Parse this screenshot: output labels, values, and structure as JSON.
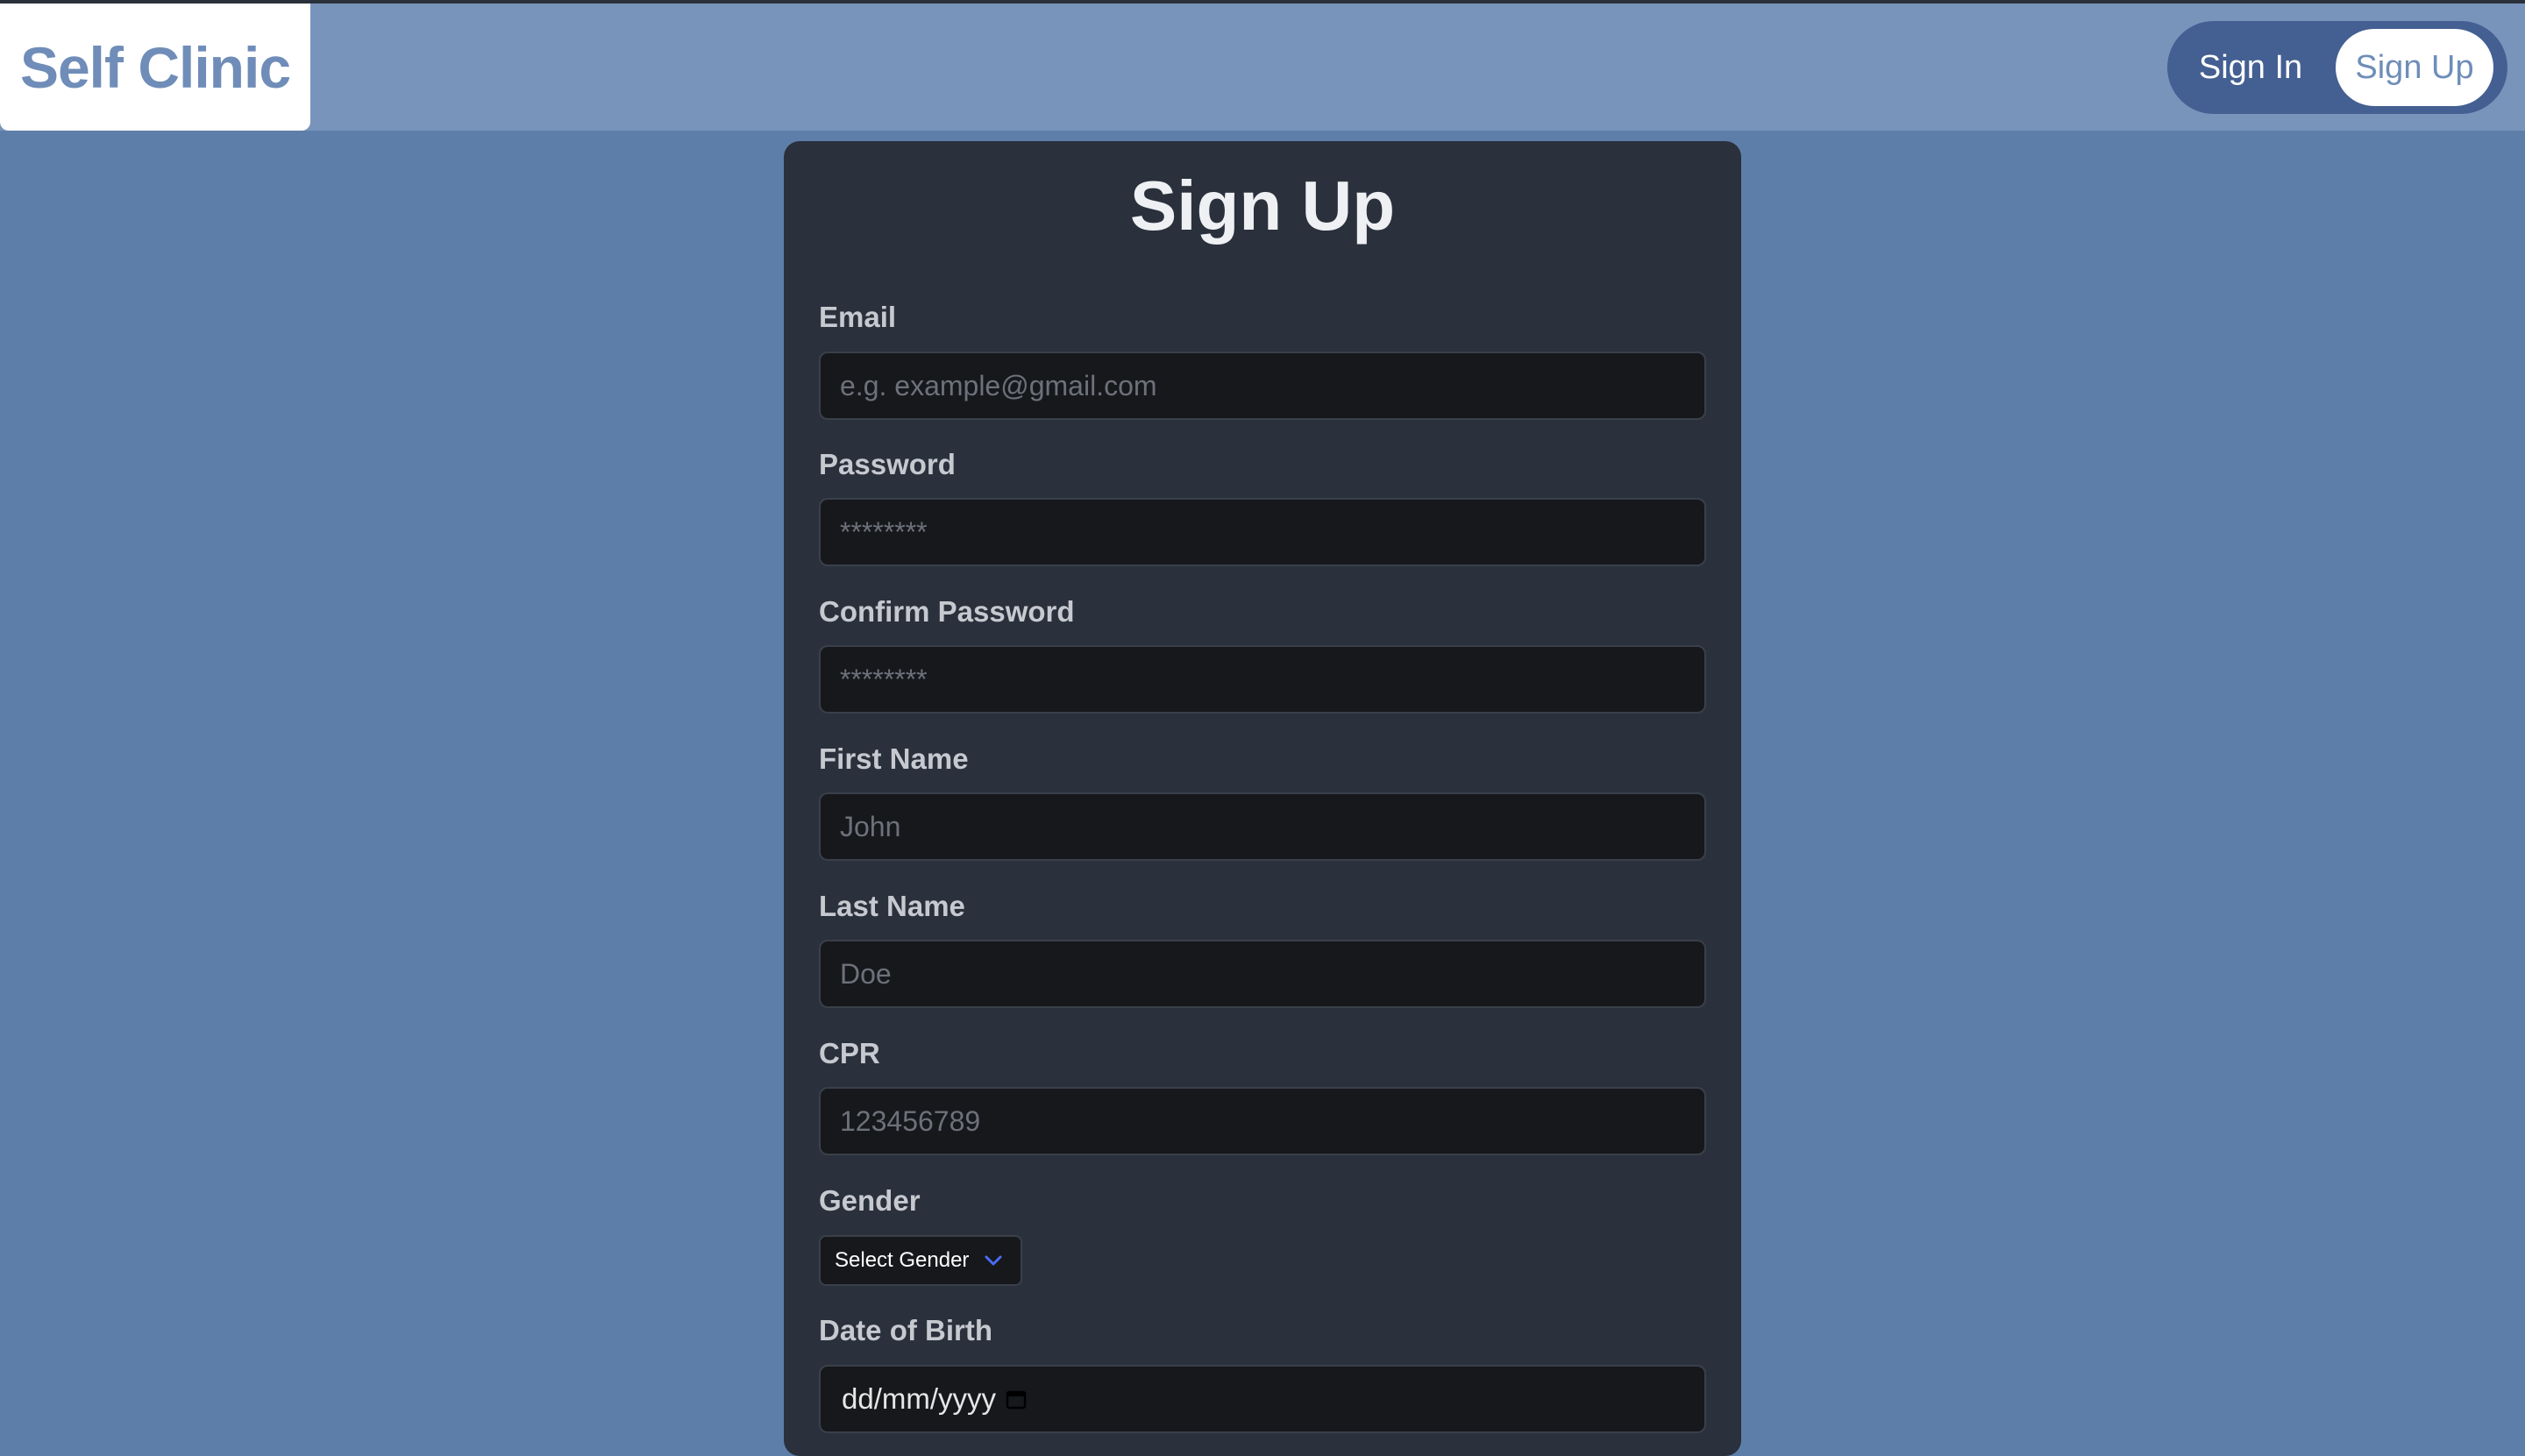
{
  "header": {
    "brand": "Self Clinic",
    "sign_in_label": "Sign In",
    "sign_up_label": "Sign Up"
  },
  "form": {
    "title": "Sign Up",
    "email": {
      "label": "Email",
      "placeholder": "e.g. example@gmail.com"
    },
    "password": {
      "label": "Password",
      "placeholder": "********"
    },
    "confirm_password": {
      "label": "Confirm Password",
      "placeholder": "********"
    },
    "first_name": {
      "label": "First Name",
      "placeholder": "John"
    },
    "last_name": {
      "label": "Last Name",
      "placeholder": "Doe"
    },
    "cpr": {
      "label": "CPR",
      "placeholder": "123456789"
    },
    "gender": {
      "label": "Gender",
      "selected": "Select Gender"
    },
    "dob": {
      "label": "Date of Birth",
      "value": "dd/mm/yyyy"
    }
  },
  "colors": {
    "page_bg": "#5d7ea8",
    "navbar_bg": "#7994bb",
    "pill_bg": "#445f92",
    "card_bg": "#2a313c",
    "input_bg": "#17181c",
    "chevron": "#4a6cf7"
  },
  "icons": {
    "select_chevron": "chevron-down-icon",
    "date_picker": "calendar-icon"
  }
}
